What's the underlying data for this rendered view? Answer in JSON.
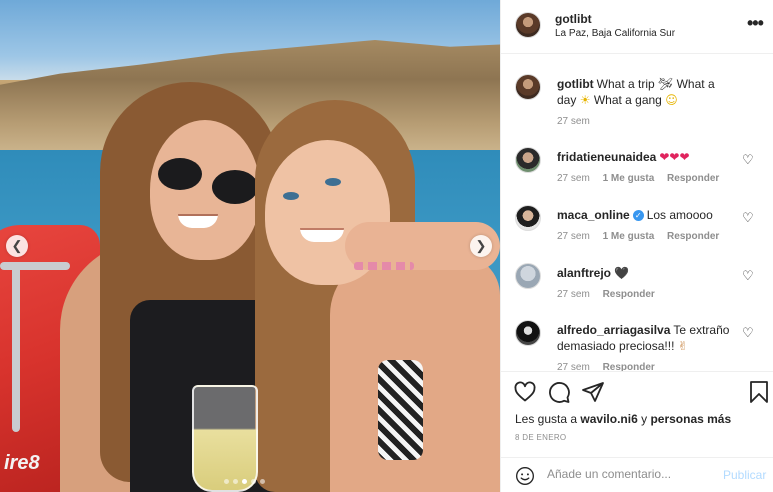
{
  "post": {
    "username": "gotlibt",
    "location": "La Paz, Baja California Sur",
    "caption_user": "gotlibt",
    "caption_text_1": "What a trip",
    "caption_text_2": "What a day",
    "caption_text_3": "What a gang",
    "caption_time": "27 sem",
    "photo_boat_text": "ire8",
    "carousel": {
      "count": 5,
      "active_index": 2
    }
  },
  "comments": [
    {
      "user": "fridatieneunaidea",
      "text": "",
      "emoji": "❤❤❤",
      "time": "27 sem",
      "likes": "1 Me gusta",
      "reply": "Responder"
    },
    {
      "user": "maca_online",
      "verified": true,
      "text": "Los amoooo",
      "time": "27 sem",
      "likes": "1 Me gusta",
      "reply": "Responder"
    },
    {
      "user": "alanftrejo",
      "text": "",
      "emoji": "🖤",
      "time": "27 sem",
      "reply": "Responder"
    },
    {
      "user": "alfredo_arriagasilva",
      "text": "Te extraño demasiado preciosa!!!",
      "emoji": "✌",
      "time": "27 sem",
      "reply": "Responder"
    }
  ],
  "actions": {
    "likes_prefix": "Les gusta a",
    "likes_user": "wavilo.ni6",
    "likes_mid": "y",
    "likes_others": "personas más",
    "date": "8 DE ENERO"
  },
  "add_comment": {
    "placeholder": "Añade un comentario...",
    "publish_label": "Publicar"
  },
  "icons": {
    "like": "heart-icon",
    "comment": "comment-icon",
    "share": "share-icon",
    "save": "bookmark-icon",
    "emoji": "emoji-icon",
    "more": "more-icon",
    "prev": "chevron-left-icon",
    "next": "chevron-right-icon"
  },
  "colors": {
    "link_disabled": "#b3dbff",
    "verified": "#3897f0",
    "muted": "#8e8e8e"
  }
}
